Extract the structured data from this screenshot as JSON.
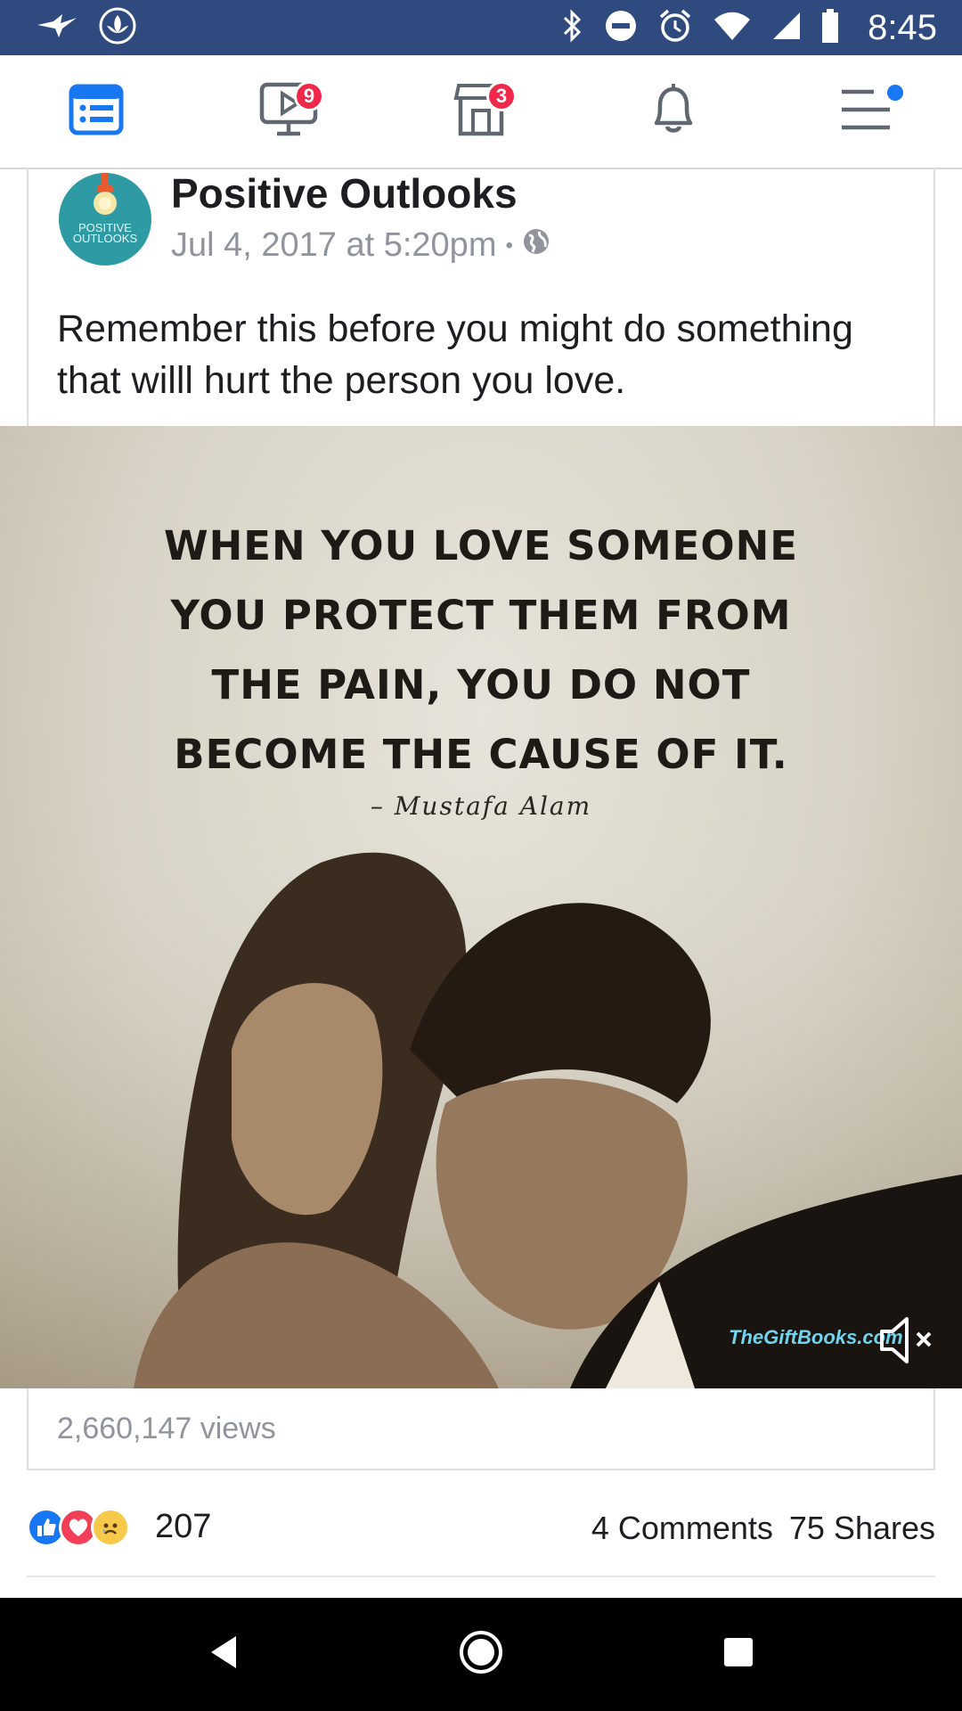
{
  "status_bar": {
    "time": "8:45",
    "icons": [
      "hummingbird-icon",
      "lotus-icon",
      "bluetooth-icon",
      "do-not-disturb-icon",
      "alarm-icon",
      "wifi-icon",
      "signal-icon",
      "battery-icon"
    ]
  },
  "nav": {
    "items": [
      {
        "name": "news-feed",
        "icon": "news-feed-icon",
        "active": true,
        "badge": null
      },
      {
        "name": "watch",
        "icon": "video-icon",
        "active": false,
        "badge": "9"
      },
      {
        "name": "marketplace",
        "icon": "marketplace-icon",
        "active": false,
        "badge": "3"
      },
      {
        "name": "notifications",
        "icon": "bell-icon",
        "active": false,
        "badge": null
      },
      {
        "name": "menu",
        "icon": "menu-icon",
        "active": false,
        "badge": null
      }
    ],
    "active_color": "#1877f2",
    "badge_color": "#f02849"
  },
  "post": {
    "author": "Positive Outlooks",
    "avatar_text": "POSITIVE OUTLOOKS",
    "timestamp": "Jul 4, 2017 at 5:20pm",
    "separator": "•",
    "privacy_icon": "globe-icon",
    "text": "Remember this before you might do something that willl hurt the person you love.",
    "media": {
      "quote_lines": [
        "WHEN YOU LOVE SOMEONE",
        "YOU PROTECT THEM FROM",
        "THE PAIN, YOU DO NOT",
        "BECOME THE CAUSE OF IT."
      ],
      "quote_author": "– Mustafa Alam",
      "watermark": "TheGiftBooks.com",
      "mute_icon": "speaker-muted-icon"
    },
    "views": "2,660,147 views",
    "reactions": {
      "icons": [
        "like-icon",
        "love-icon",
        "sad-icon"
      ],
      "count": "207",
      "comments": "4 Comments",
      "shares": "75 Shares"
    }
  },
  "system_nav": {
    "buttons": [
      "back-icon",
      "home-icon",
      "recents-icon"
    ]
  }
}
